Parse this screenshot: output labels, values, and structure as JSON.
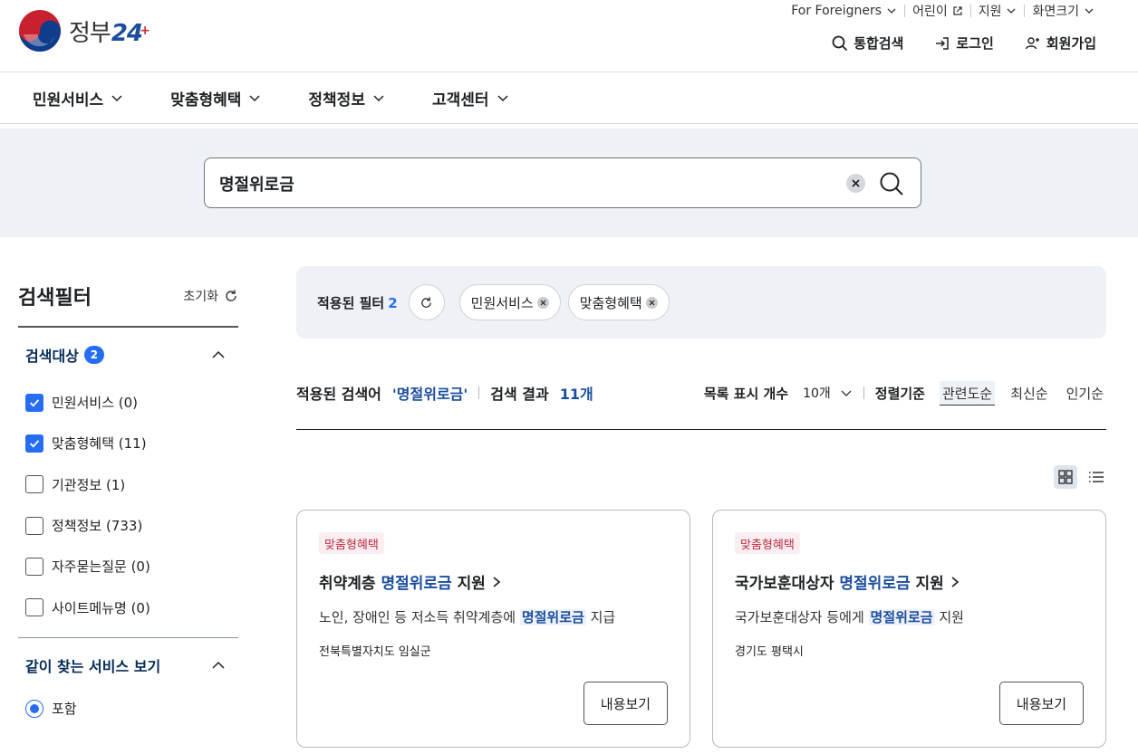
{
  "brand": {
    "text_main": "정부",
    "text_num": "24"
  },
  "util_nav": [
    {
      "label": "For Foreigners",
      "icon": "chevron-down-icon"
    },
    {
      "label": "어린이",
      "icon": "external-link-icon"
    },
    {
      "label": "지원",
      "icon": "chevron-down-icon"
    },
    {
      "label": "화면크기",
      "icon": "chevron-down-icon"
    }
  ],
  "actions": {
    "search_label": "통합검색",
    "login_label": "로그인",
    "signup_label": "회원가입"
  },
  "gnb": [
    {
      "label": "민원서비스"
    },
    {
      "label": "맞춤형혜택"
    },
    {
      "label": "정책정보"
    },
    {
      "label": "고객센터"
    }
  ],
  "search": {
    "query": "명절위로금"
  },
  "sidebar": {
    "title": "검색필터",
    "reset_label": "초기화",
    "target_section": {
      "title": "검색대상",
      "badge": "2",
      "options": [
        {
          "label": "민원서비스 (0)",
          "checked": true
        },
        {
          "label": "맞춤형혜택 (11)",
          "checked": true
        },
        {
          "label": "기관정보 (1)",
          "checked": false
        },
        {
          "label": "정책정보 (733)",
          "checked": false
        },
        {
          "label": "자주묻는질문 (0)",
          "checked": false
        },
        {
          "label": "사이트메뉴명 (0)",
          "checked": false
        }
      ]
    },
    "related_section": {
      "title": "같이 찾는 서비스 보기",
      "radio_label": "포함"
    }
  },
  "applied_filters": {
    "label": "적용된 필터",
    "count": "2",
    "chips": [
      "민원서비스",
      "맞춤형혜택"
    ]
  },
  "summary": {
    "query_label": "적용된 검색어",
    "query_value": "'명절위로금'",
    "result_label": "검색 결과",
    "result_count": "11개",
    "page_size_label": "목록 표시 개수",
    "page_size_value": "10개",
    "sort_label": "정렬기준",
    "sort_options": [
      "관련도순",
      "최신순",
      "인기순"
    ]
  },
  "colors": {
    "accent": "#256ef4",
    "highlight_text": "#1a4d9e",
    "badge_bg": "#fbeef0",
    "badge_text": "#bd2c3f",
    "band_bg": "#eef1f5"
  },
  "cards": [
    {
      "badge": "맞춤형혜택",
      "title_pre": "취약계층 ",
      "title_hl": "명절위로금",
      "title_post": " 지원",
      "desc_pre": "노인, 장애인 등 저소득 취약계층에 ",
      "desc_hl": "명절위로금",
      "desc_post": " 지급",
      "org": "전북특별자치도 임실군",
      "button": "내용보기"
    },
    {
      "badge": "맞춤형혜택",
      "title_pre": "국가보훈대상자 ",
      "title_hl": "명절위로금",
      "title_post": " 지원",
      "desc_pre": "국가보훈대상자 등에게 ",
      "desc_hl": "명절위로금",
      "desc_post": " 지원",
      "org": "경기도 평택시",
      "button": "내용보기"
    }
  ]
}
